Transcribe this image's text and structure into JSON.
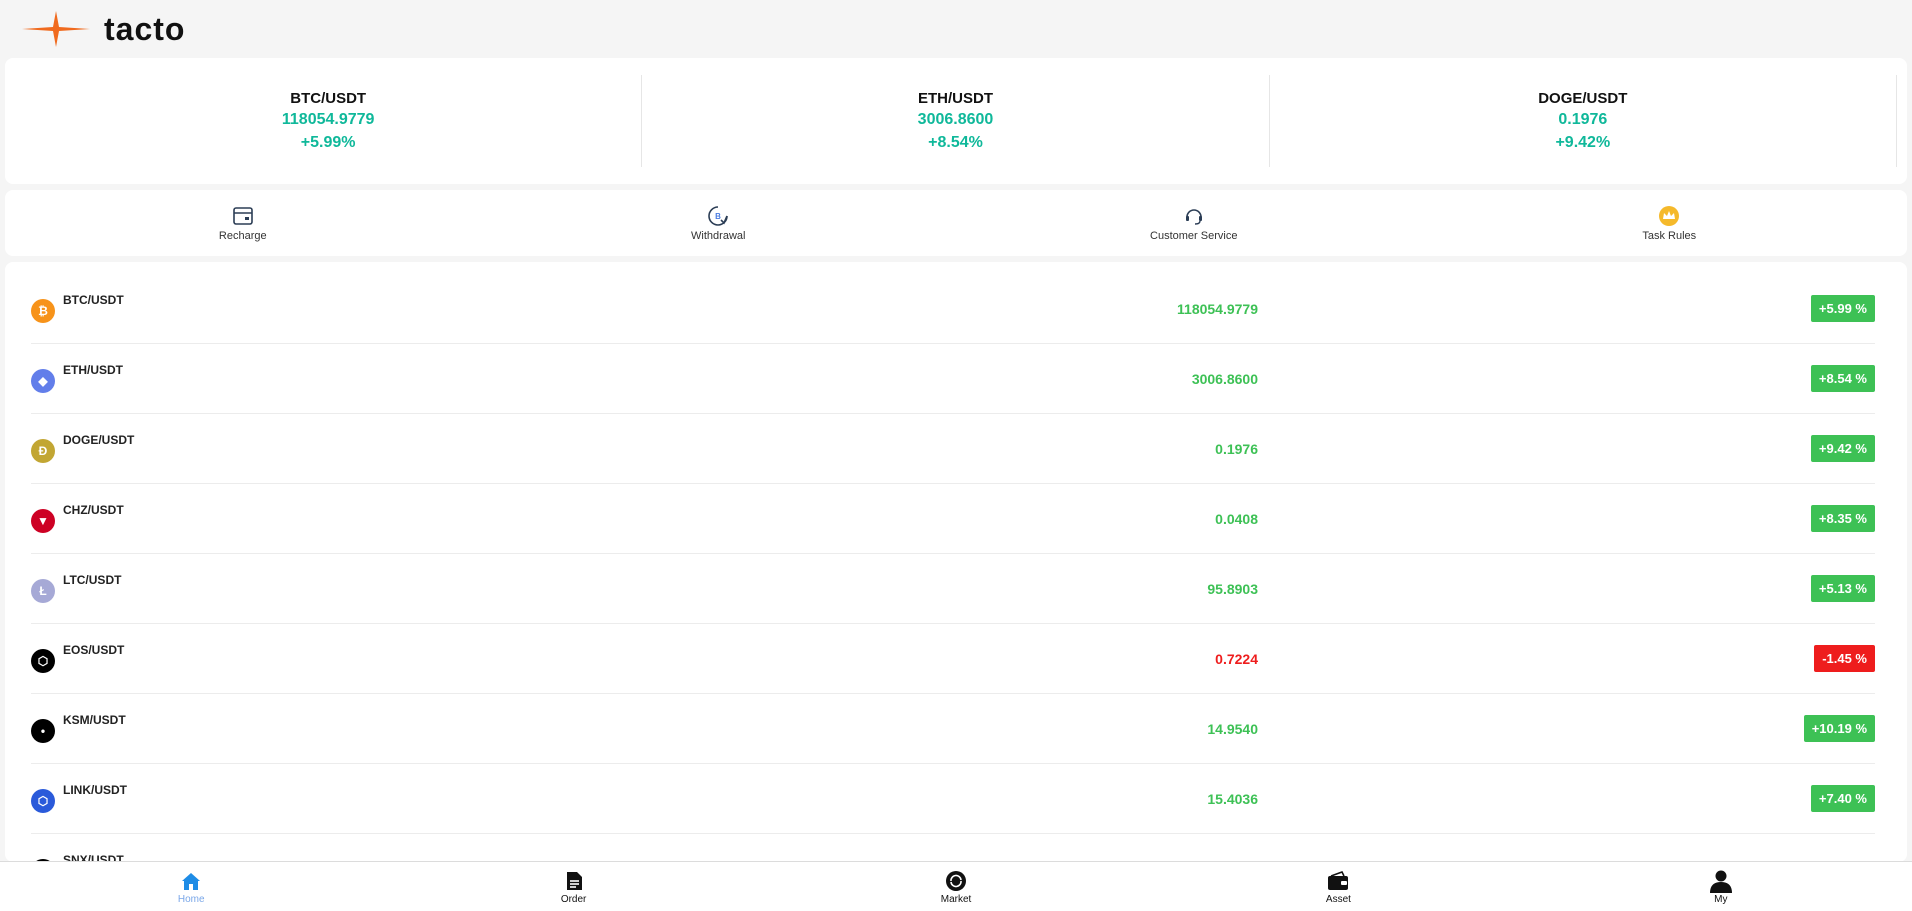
{
  "brand": {
    "name": "tacto"
  },
  "tickers": [
    {
      "pair": "BTC/USDT",
      "price": "118054.9779",
      "change": "+5.99%"
    },
    {
      "pair": "ETH/USDT",
      "price": "3006.8600",
      "change": "+8.54%"
    },
    {
      "pair": "DOGE/USDT",
      "price": "0.1976",
      "change": "+9.42%"
    }
  ],
  "quick_actions": [
    {
      "label": "Recharge",
      "icon": "wallet-card-icon"
    },
    {
      "label": "Withdrawal",
      "icon": "bitcoin-withdraw-icon"
    },
    {
      "label": "Customer Service",
      "icon": "headset-icon"
    },
    {
      "label": "Task Rules",
      "icon": "crown-icon"
    }
  ],
  "market": {
    "rows": [
      {
        "pair": "BTC/USDT",
        "price": "118054.9779",
        "change": "+5.99 %",
        "direction": "up",
        "icon_color": "#f7931a",
        "icon_glyph": "₿"
      },
      {
        "pair": "ETH/USDT",
        "price": "3006.8600",
        "change": "+8.54 %",
        "direction": "up",
        "icon_color": "#627eea",
        "icon_glyph": "◆"
      },
      {
        "pair": "DOGE/USDT",
        "price": "0.1976",
        "change": "+9.42 %",
        "direction": "up",
        "icon_color": "#c2a633",
        "icon_glyph": "Ð"
      },
      {
        "pair": "CHZ/USDT",
        "price": "0.0408",
        "change": "+8.35 %",
        "direction": "up",
        "icon_color": "#cd0124",
        "icon_glyph": "▼"
      },
      {
        "pair": "LTC/USDT",
        "price": "95.8903",
        "change": "+5.13 %",
        "direction": "up",
        "icon_color": "#a6a9d6",
        "icon_glyph": "Ł"
      },
      {
        "pair": "EOS/USDT",
        "price": "0.7224",
        "change": "-1.45 %",
        "direction": "down",
        "icon_color": "#000000",
        "icon_glyph": "⬡"
      },
      {
        "pair": "KSM/USDT",
        "price": "14.9540",
        "change": "+10.19 %",
        "direction": "up",
        "icon_color": "#000000",
        "icon_glyph": "•"
      },
      {
        "pair": "LINK/USDT",
        "price": "15.4036",
        "change": "+7.40 %",
        "direction": "up",
        "icon_color": "#2a5ada",
        "icon_glyph": "⬡"
      },
      {
        "pair": "SNX/USDT",
        "price": "",
        "change": "",
        "direction": "up",
        "icon_color": "#000000",
        "icon_glyph": ""
      }
    ]
  },
  "bottom_nav": [
    {
      "label": "Home",
      "icon": "home-icon",
      "active": true
    },
    {
      "label": "Order",
      "icon": "document-icon",
      "active": false
    },
    {
      "label": "Market",
      "icon": "market-icon",
      "active": false
    },
    {
      "label": "Asset",
      "icon": "wallet-icon",
      "active": false
    },
    {
      "label": "My",
      "icon": "user-icon",
      "active": false
    }
  ],
  "colors": {
    "up": "#3dc155",
    "down": "#ee1d1d",
    "ticker_green": "#0fb89a",
    "active_nav": "#7aa7e8"
  }
}
